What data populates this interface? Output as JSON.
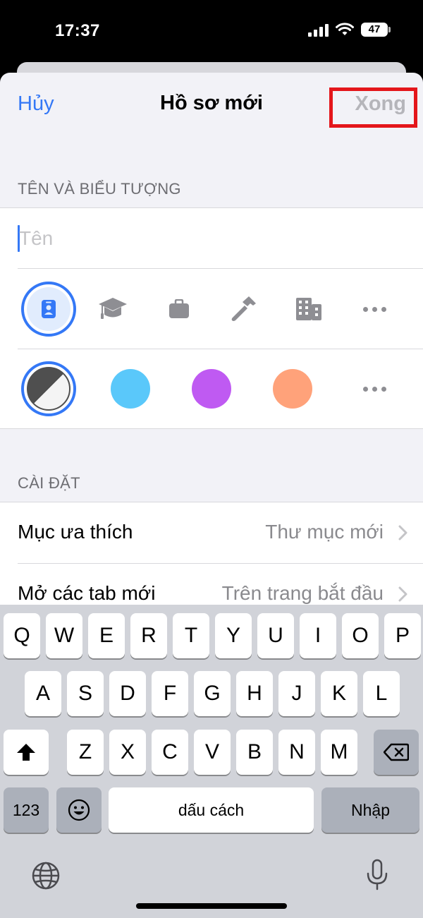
{
  "status_bar": {
    "time": "17:37",
    "battery": "47"
  },
  "nav": {
    "cancel_label": "Hủy",
    "title": "Hồ sơ mới",
    "done_label": "Xong"
  },
  "name_section": {
    "header": "TÊN VÀ BIỂU TƯỢNG",
    "name_placeholder": "Tên",
    "name_value": "",
    "icons": [
      "id-badge-icon",
      "graduation-cap-icon",
      "briefcase-icon",
      "hammer-icon",
      "building-icon",
      "more-icon"
    ],
    "selected_icon": "id-badge-icon"
  },
  "colors": {
    "options": [
      "#4f4f4f",
      "#5ac8fa",
      "#bf5af2",
      "#ffa27a"
    ],
    "selected": "#4f4f4f",
    "accent": "#3478f6"
  },
  "settings_section": {
    "header": "CÀI ĐẶT",
    "rows": [
      {
        "label": "Mục ưa thích",
        "value": "Thư mục mới"
      },
      {
        "label": "Mở các tab mới",
        "value": "Trên trang bắt đầu"
      }
    ]
  },
  "keyboard": {
    "row1": [
      "Q",
      "W",
      "E",
      "R",
      "T",
      "Y",
      "U",
      "I",
      "O",
      "P"
    ],
    "row2": [
      "A",
      "S",
      "D",
      "F",
      "G",
      "H",
      "J",
      "K",
      "L"
    ],
    "row3": [
      "Z",
      "X",
      "C",
      "V",
      "B",
      "N",
      "M"
    ],
    "numbers_label": "123",
    "space_label": "dấu cách",
    "return_label": "Nhập"
  }
}
